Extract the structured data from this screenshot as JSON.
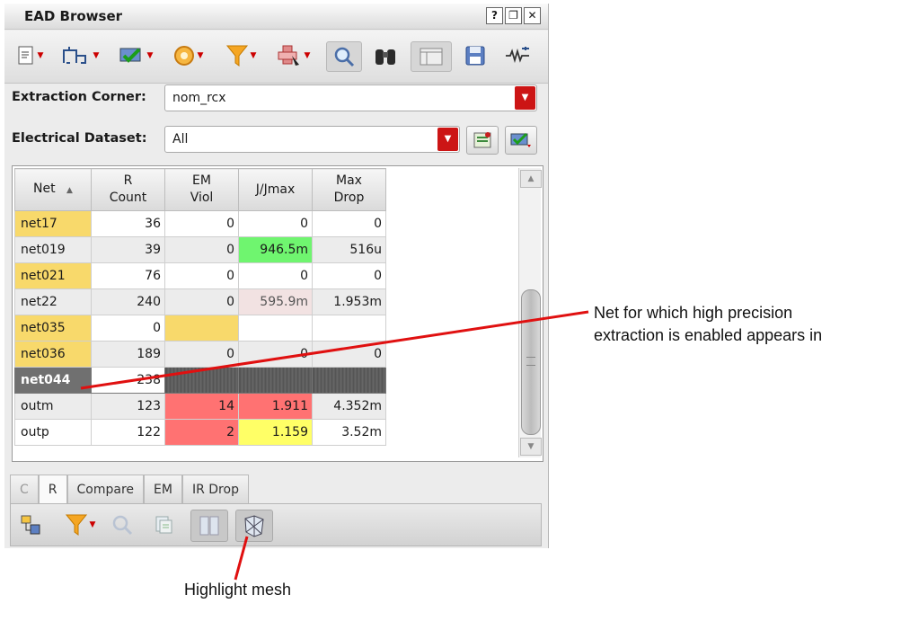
{
  "window": {
    "title": "EAD Browser",
    "controls": [
      "?",
      "❐",
      "✕"
    ]
  },
  "toolbar_icons": [
    "page-icon",
    "circuit-icon",
    "check-icon",
    "cycle-icon",
    "filter-icon",
    "probe-icon",
    "zoom-icon",
    "binoculars-icon",
    "panel-icon",
    "save-icon",
    "resistor-icon"
  ],
  "extraction": {
    "label": "Extraction Corner:",
    "value": "nom_rcx"
  },
  "dataset": {
    "label": "Electrical Dataset:",
    "value": "All"
  },
  "table": {
    "headers": [
      "Net",
      "R\nCount",
      "EM\nViol",
      "J/Jmax",
      "Max\nDrop"
    ],
    "rows": [
      [
        "net17",
        "36",
        "0",
        "0",
        "0"
      ],
      [
        "net019",
        "39",
        "0",
        "946.5m",
        "516u"
      ],
      [
        "net021",
        "76",
        "0",
        "0",
        "0"
      ],
      [
        "net22",
        "240",
        "0",
        "595.9m",
        "1.953m"
      ],
      [
        "net035",
        "0",
        "",
        "",
        ""
      ],
      [
        "net036",
        "189",
        "0",
        "0",
        "0"
      ],
      [
        "net044",
        "238",
        "",
        "",
        ""
      ],
      [
        "outm",
        "123",
        "14",
        "1.911",
        "4.352m"
      ],
      [
        "outp",
        "122",
        "2",
        "1.159",
        "3.52m"
      ]
    ],
    "selected_row": "net044",
    "sort_indicator": "▲"
  },
  "tabs": [
    "C",
    "R",
    "Compare",
    "EM",
    "IR Drop"
  ],
  "active_tab": "R",
  "bottom_toolbar_icons": [
    "layout-icon",
    "filter-icon",
    "zoom-icon",
    "copy-icon",
    "split-icon",
    "mesh-icon"
  ],
  "annotations": {
    "net_note_line1": "Net for which high precision",
    "net_note_line2": "extraction is enabled appears in",
    "mesh_note": "Highlight mesh"
  },
  "colors": {
    "highlight_yellow": "#f8d96b",
    "ok_green": "#6ff56f",
    "violation_red": "#ff7272",
    "warning_yellow": "#ffff66",
    "callout_red": "#e01010",
    "dropdown_red": "#cc1515"
  }
}
